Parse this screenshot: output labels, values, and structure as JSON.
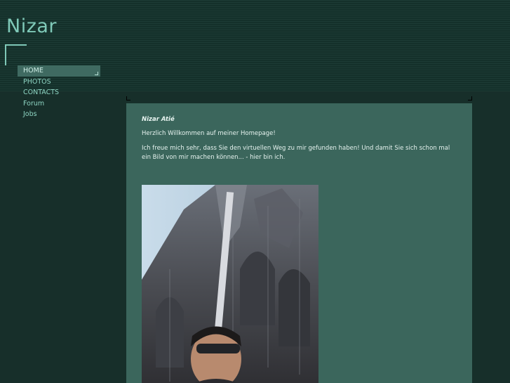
{
  "site": {
    "title": "Nizar"
  },
  "nav": {
    "items": [
      {
        "label": "HOME",
        "active": true
      },
      {
        "label": "PHOTOS",
        "active": false
      },
      {
        "label": "CONTACTS",
        "active": false
      },
      {
        "label": "Forum",
        "active": false
      },
      {
        "label": "Jobs",
        "active": false
      }
    ]
  },
  "content": {
    "heading": "Nizar Atié",
    "greeting": "Herzlich Willkommen auf meiner Homepage!",
    "paragraph": "Ich freue mich sehr, dass Sie den virtuellen Weg zu mir gefunden haben! Und damit Sie sich schon mal ein Bild von mir machen können... - hier bin ich."
  },
  "colors": {
    "background": "#16302b",
    "accent": "#7fc9b8",
    "nav_active": "#3f6a61",
    "content_panel": "#3b665c"
  },
  "icons": [
    "corner-bracket-icon"
  ]
}
